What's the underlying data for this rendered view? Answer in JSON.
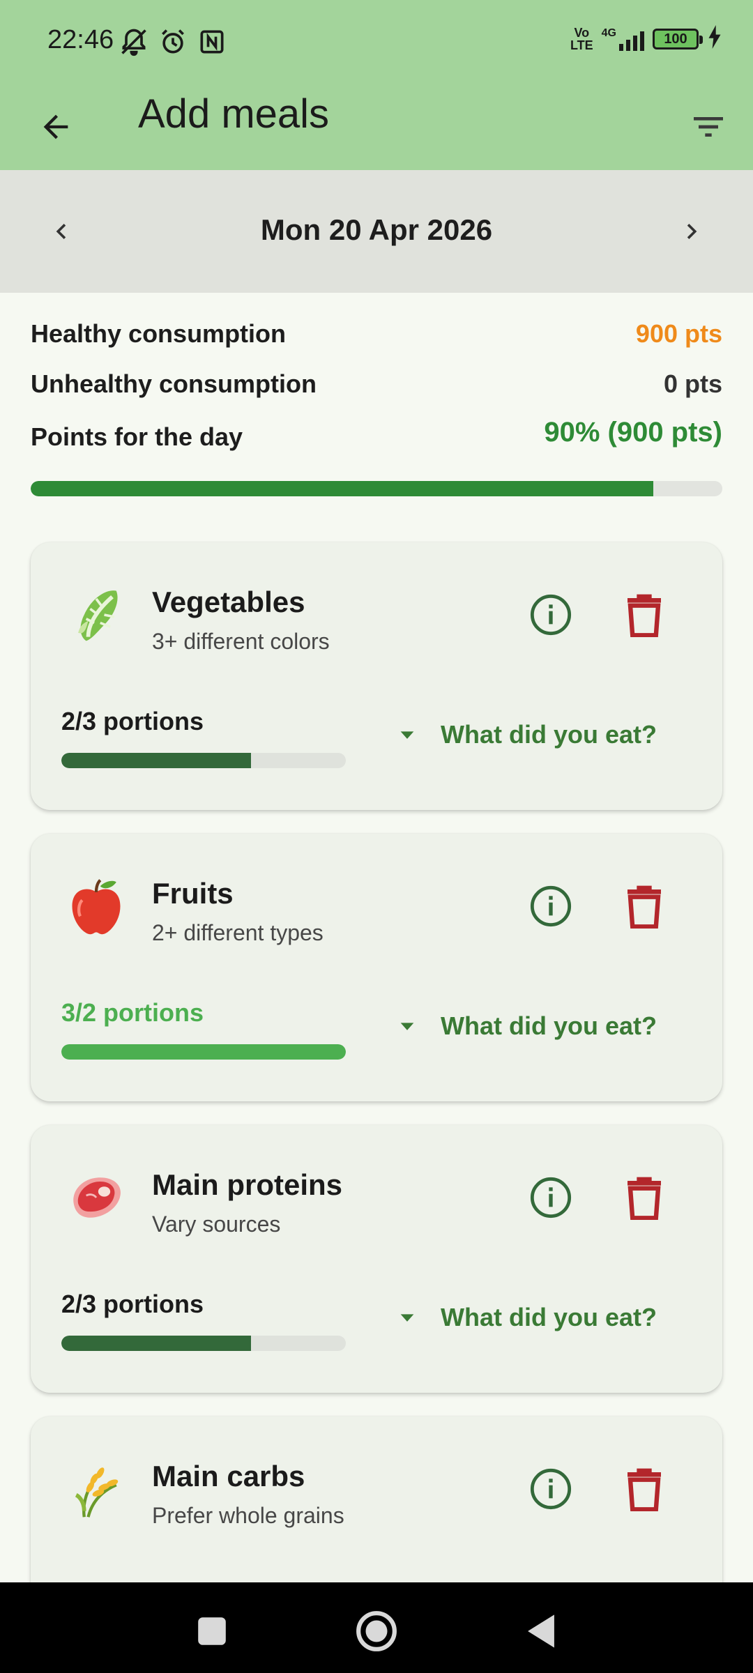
{
  "status_bar": {
    "time": "22:46",
    "net_label": "4G",
    "volte_label": "Vo\nLTE",
    "battery": "100"
  },
  "app_bar": {
    "title": "Add meals"
  },
  "date_bar": {
    "date": "Mon 20 Apr 2026"
  },
  "summary": {
    "healthy_label": "Healthy consumption",
    "healthy_value": "900 pts",
    "unhealthy_label": "Unhealthy consumption",
    "unhealthy_value": "0 pts",
    "day_label": "Points for the day",
    "day_value": "90% (900 pts)",
    "day_progress": 0.9
  },
  "cards": [
    {
      "name": "Vegetables",
      "subtitle": "3+ different colors",
      "portions": "2/3 portions",
      "progress": 0.667,
      "action": "What did you eat?",
      "icon": "lettuce-icon"
    },
    {
      "name": "Fruits",
      "subtitle": "2+ different types",
      "portions": "3/2 portions",
      "progress": 1.0,
      "action": "What did you eat?",
      "icon": "apple-icon"
    },
    {
      "name": "Main proteins",
      "subtitle": "Vary sources",
      "portions": "2/3 portions",
      "progress": 0.667,
      "action": "What did you eat?",
      "icon": "meat-icon"
    },
    {
      "name": "Main carbs",
      "subtitle": "Prefer whole grains",
      "icon": "grain-icon"
    }
  ],
  "colors": {
    "app_bar": "#a3d49b",
    "accent_orange": "#ef8a1a",
    "accent_green": "#2e8b36",
    "complete_green": "#4caf50",
    "dark_green": "#33693a",
    "delete_red": "#b3262b"
  }
}
